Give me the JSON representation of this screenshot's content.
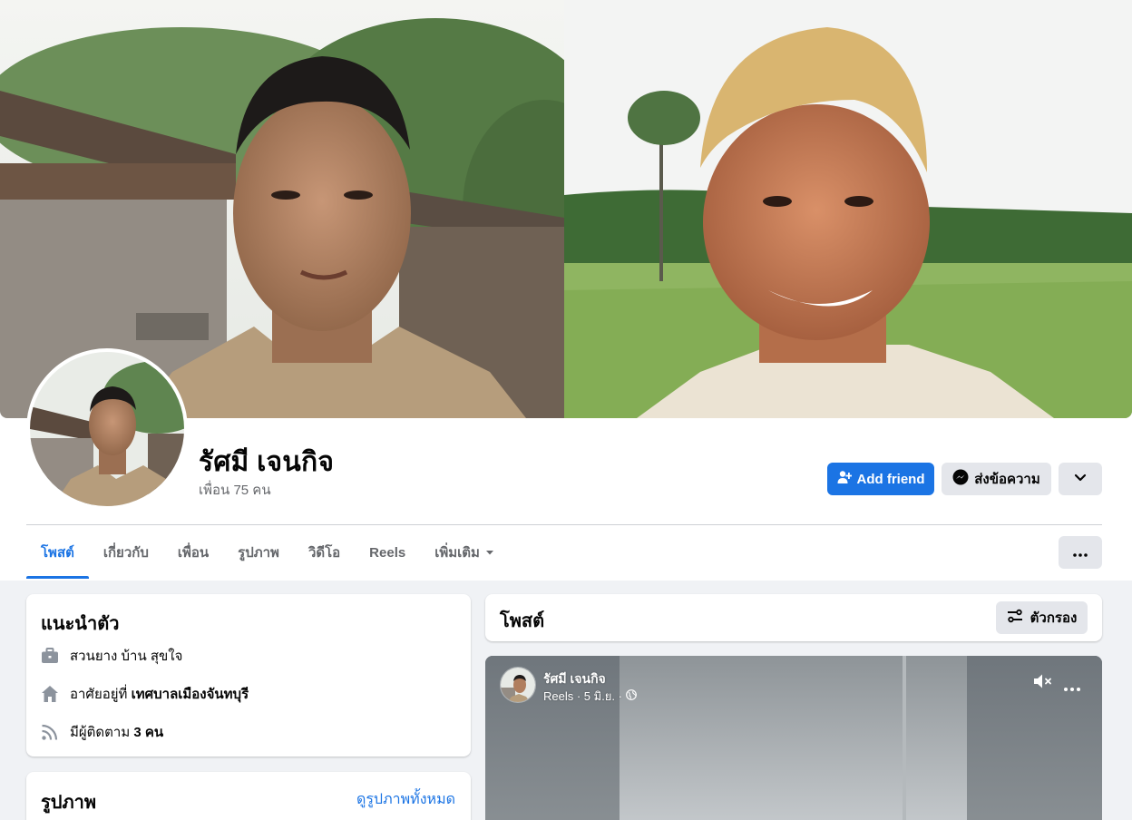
{
  "profile": {
    "name": "รัศมี เจนกิจ",
    "friends": "เพื่อน 75 คน"
  },
  "actions": {
    "add_friend": "Add friend",
    "message": "ส่งข้อความ"
  },
  "tabs": [
    {
      "label": "โพสต์",
      "active": true
    },
    {
      "label": "เกี่ยวกับ"
    },
    {
      "label": "เพื่อน"
    },
    {
      "label": "รูปภาพ"
    },
    {
      "label": "วิดีโอ"
    },
    {
      "label": "Reels"
    },
    {
      "label": "เพิ่มเติม"
    }
  ],
  "intro": {
    "title": "แนะนำตัว",
    "work": {
      "text": "สวนยาง บ้าน สุขใจ",
      "icon": "briefcase-icon"
    },
    "lives": {
      "prefix": "อาศัยอยู่ที่ ",
      "place": "เทศบาลเมืองจันทบุรี",
      "icon": "home-icon"
    },
    "followers": {
      "prefix": "มีผู้ติดตาม ",
      "count": "3 คน",
      "icon": "rss-icon"
    }
  },
  "photos": {
    "title": "รูปภาพ",
    "see_all": "ดูรูปภาพทั้งหมด"
  },
  "posts": {
    "title": "โพสต์",
    "filter": "ตัวกรอง"
  },
  "reel_post": {
    "author": "รัศมี เจนกิจ",
    "meta": "Reels · 5 มิ.ย. ·"
  },
  "colors": {
    "accent": "#1b74e4",
    "secondary_button": "#e4e6eb",
    "feed_background": "#f0f2f5",
    "muted_text": "#65676b"
  }
}
